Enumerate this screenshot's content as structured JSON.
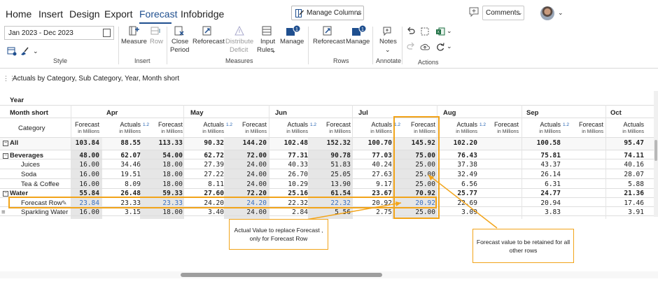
{
  "tabs": [
    "Home",
    "Insert",
    "Design",
    "Export",
    "Forecast",
    "Infobridge"
  ],
  "active_tab": "Forecast",
  "manage_columns_label": "Manage Columns",
  "comments_label": "Comments",
  "ribbon": {
    "date_range": "Jan 2023 - Dec 2023",
    "groups": {
      "style": "Style",
      "insert": "Insert",
      "measures": "Measures",
      "rows": "Rows",
      "annotate": "Annotate",
      "actions": "Actions"
    },
    "buttons": {
      "measure": "Measure",
      "row": "Row",
      "close_period_1": "Close",
      "close_period_2": "Period",
      "reforecast": "Reforecast",
      "distribute_deficit_1": "Distribute",
      "distribute_deficit_2": "Deficit",
      "input_rules_1": "Input",
      "input_rules_2": "Rules",
      "manage": "Manage",
      "rows_reforecast": "Reforecast",
      "rows_manage": "Manage",
      "notes": "Notes"
    },
    "badges": {
      "manage": "1",
      "rows_manage": "1"
    }
  },
  "report_title": "Actuals by Category, Sub Category, Year, Month short",
  "grid": {
    "row_headers": {
      "year": "Year",
      "month_short": "Month short",
      "category": "Category"
    },
    "months": [
      "Apr",
      "May",
      "Jun",
      "Jul",
      "Aug",
      "Sep",
      "Oct"
    ],
    "col_headers": {
      "forecast": "Forecast",
      "actuals": "Actuals",
      "unit": "in Millions",
      "badge": "1.2"
    },
    "rows": [
      {
        "label": "All",
        "bold": true,
        "values": [
          "103.84",
          "88.55",
          "113.33",
          "90.32",
          "144.20",
          "102.48",
          "152.32",
          "100.70",
          "145.92",
          "102.20",
          "",
          "100.58",
          "",
          "95.47"
        ]
      },
      {
        "label": "Beverages",
        "bold": true,
        "values": [
          "48.00",
          "62.07",
          "54.00",
          "62.72",
          "72.00",
          "77.31",
          "90.78",
          "77.03",
          "75.00",
          "76.43",
          "",
          "75.81",
          "",
          "74.11"
        ]
      },
      {
        "label": "Juices",
        "bold": false,
        "values": [
          "16.00",
          "34.46",
          "18.00",
          "27.39",
          "24.00",
          "40.33",
          "51.83",
          "40.24",
          "25.00",
          "37.38",
          "",
          "43.37",
          "",
          "40.16"
        ]
      },
      {
        "label": "Soda",
        "bold": false,
        "values": [
          "16.00",
          "19.51",
          "18.00",
          "27.22",
          "24.00",
          "26.70",
          "25.05",
          "27.63",
          "25.00",
          "32.49",
          "",
          "26.14",
          "",
          "28.07"
        ]
      },
      {
        "label": "Tea & Coffee",
        "bold": false,
        "values": [
          "16.00",
          "8.09",
          "18.00",
          "8.11",
          "24.00",
          "10.29",
          "13.90",
          "9.17",
          "25.00",
          "6.56",
          "",
          "6.31",
          "",
          "5.88"
        ]
      },
      {
        "label": "Water",
        "bold": true,
        "values": [
          "55.84",
          "26.48",
          "59.33",
          "27.60",
          "72.20",
          "25.16",
          "61.54",
          "23.67",
          "70.92",
          "25.77",
          "",
          "24.77",
          "",
          "21.36"
        ]
      },
      {
        "label": "Forecast Row",
        "bold": false,
        "values": [
          "23.84",
          "23.33",
          "23.33",
          "24.20",
          "24.20",
          "22.32",
          "22.32",
          "20.92",
          "20.92",
          "22.69",
          "",
          "20.94",
          "",
          "17.46"
        ]
      },
      {
        "label": "Sparkling Water",
        "bold": false,
        "values": [
          "16.00",
          "3.15",
          "18.00",
          "3.40",
          "24.00",
          "2.84",
          "5.56",
          "2.75",
          "25.00",
          "3.09",
          "",
          "3.83",
          "",
          "3.91"
        ]
      }
    ]
  },
  "callouts": {
    "left": "Actual Value to replace Forecast , only for Forecast Row",
    "right": "Forecast value to be retained for all other rows"
  },
  "colors": {
    "accent": "#1f4f8f",
    "highlight": "#f2a41a",
    "blue_value": "#3a6fc0"
  }
}
